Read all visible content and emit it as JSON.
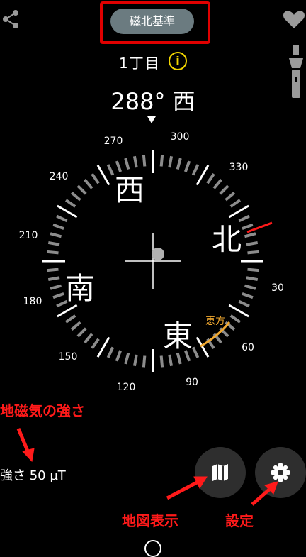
{
  "header": {
    "mode_button": "磁北基準",
    "location": "1丁目",
    "info_symbol": "i",
    "heading_degrees": "288°",
    "heading_direction": "西"
  },
  "compass": {
    "ring_numbers": [
      "30",
      "60",
      "90",
      "120",
      "150",
      "180",
      "210",
      "240",
      "270",
      "300",
      "330"
    ],
    "cardinals": {
      "north": "北",
      "east": "東",
      "south": "南",
      "west": "西"
    },
    "ehou_label": "恵方",
    "colors": {
      "north_marker": "#ff1a1a",
      "ehou": "#f0a830",
      "ring": "#8c8c8c"
    }
  },
  "status": {
    "field_strength": "強さ 50 µT"
  },
  "annotations": {
    "magnetic_strength": "地磁気の強さ",
    "map_display": "地図表示",
    "settings": "設定"
  },
  "icons": [
    "share-icon",
    "heart-icon",
    "flashlight-icon",
    "map-icon",
    "gear-icon"
  ]
}
